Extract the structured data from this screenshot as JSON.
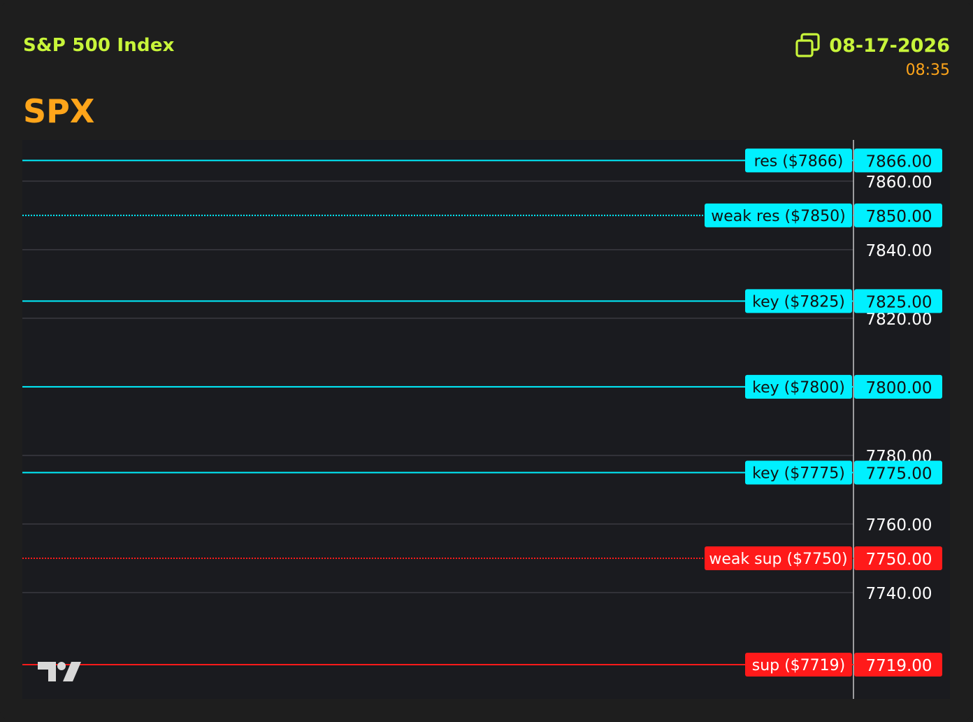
{
  "header": {
    "index_name": "S&P 500 Index",
    "ticker": "SPX",
    "date": "08-17-2026",
    "time": "08:35"
  },
  "icons": {
    "copy": "copy-icon",
    "logo": "tradingview-logo"
  },
  "colors": {
    "background": "#1e1e1e",
    "chart_bg": "#1a1b1f",
    "title": "#c8f53a",
    "accent": "#ffa51a",
    "resistance": "#00f0ff",
    "support": "#ff1a1a",
    "grid": "#3a3b40",
    "axis_text": "#ffffff"
  },
  "chart_data": {
    "type": "line",
    "ylim": [
      7709,
      7872
    ],
    "ticks": [
      7860,
      7840,
      7820,
      7780,
      7760,
      7740
    ],
    "grid": true,
    "levels": [
      {
        "label": "res ($7866)",
        "value": 7866,
        "price_label": "7866.00",
        "kind": "resistance",
        "style": "solid"
      },
      {
        "label": "weak res ($7850)",
        "value": 7850,
        "price_label": "7850.00",
        "kind": "resistance",
        "style": "dotted"
      },
      {
        "label": "key ($7825)",
        "value": 7825,
        "price_label": "7825.00",
        "kind": "resistance",
        "style": "solid"
      },
      {
        "label": "key ($7800)",
        "value": 7800,
        "price_label": "7800.00",
        "kind": "resistance",
        "style": "solid"
      },
      {
        "label": "key ($7775)",
        "value": 7775,
        "price_label": "7775.00",
        "kind": "resistance",
        "style": "solid"
      },
      {
        "label": "weak sup ($7750)",
        "value": 7750,
        "price_label": "7750.00",
        "kind": "support",
        "style": "dotted"
      },
      {
        "label": "sup ($7719)",
        "value": 7719,
        "price_label": "7719.00",
        "kind": "support",
        "style": "solid"
      }
    ]
  }
}
